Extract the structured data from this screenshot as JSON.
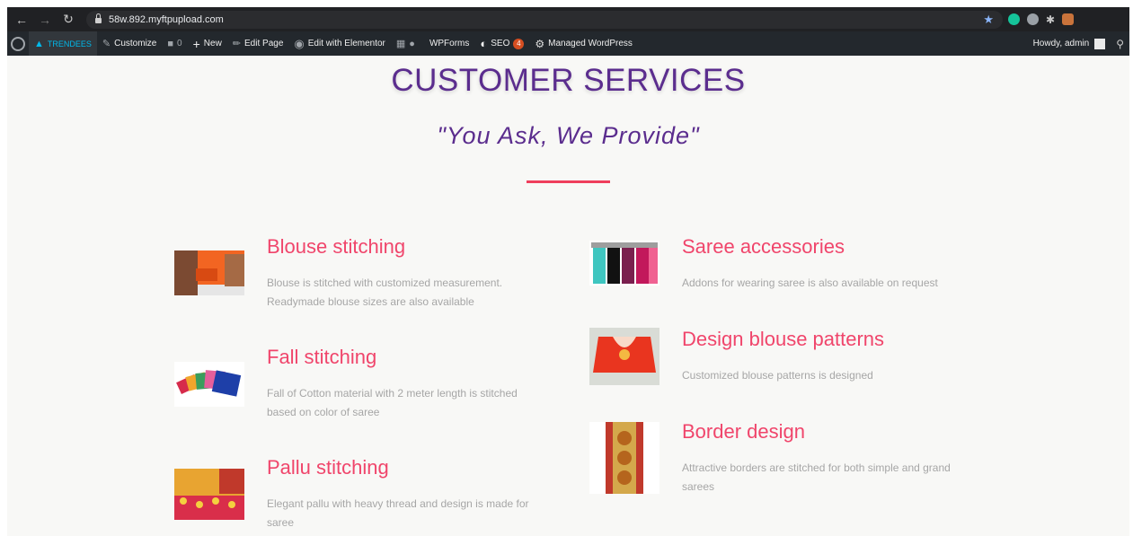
{
  "browser": {
    "url": "58w.892.myftpupload.com"
  },
  "admin_bar": {
    "site": "TRENDEES",
    "customize": "Customize",
    "comments_count": "0",
    "new": "New",
    "edit_page": "Edit Page",
    "elementor": "Edit with Elementor",
    "wpforms": "WPForms",
    "seo": "SEO",
    "seo_badge": "4",
    "managed_wp": "Managed WordPress",
    "howdy": "Howdy, admin"
  },
  "page": {
    "title": "CUSTOMER SERVICES",
    "tagline": "\"You Ask, We Provide\""
  },
  "services_left": [
    {
      "title": "Blouse stitching",
      "desc": "Blouse is stitched with customized measurement. Readymade blouse sizes are also available"
    },
    {
      "title": "Fall stitching",
      "desc": "Fall of Cotton material with 2 meter length is stitched based on color of saree"
    },
    {
      "title": "Pallu stitching",
      "desc": "Elegant pallu with heavy thread and design is made for saree"
    }
  ],
  "services_right": [
    {
      "title": "Saree accessories",
      "desc": "Addons for wearing saree is also available on request"
    },
    {
      "title": "Design blouse patterns",
      "desc": "Customized blouse patterns is designed"
    },
    {
      "title": "Border design",
      "desc": "Attractive borders are stitched for both simple and grand sarees"
    }
  ],
  "colors": {
    "title_purple": "#5b2d8e",
    "service_pink": "#f0456b",
    "divider_red": "#ef3e5c"
  }
}
